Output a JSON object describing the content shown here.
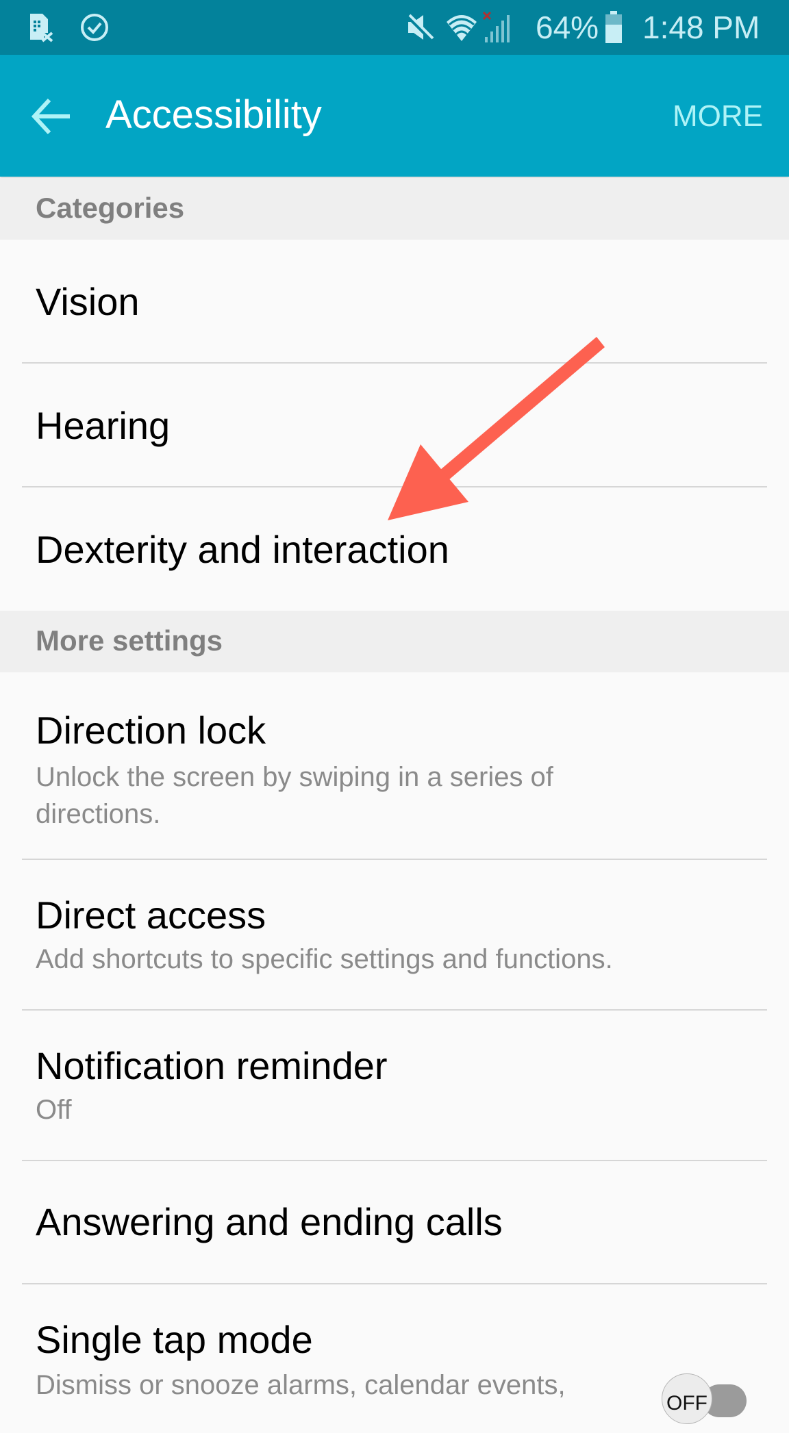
{
  "status_bar": {
    "left_icons": [
      "sim-card-error-icon",
      "check-circle-icon"
    ],
    "right_icons": [
      "mute-icon",
      "wifi-icon",
      "signal-no-service-icon",
      "battery-icon"
    ],
    "battery_percent": "64%",
    "time": "1:48 PM",
    "background_color": "#03829b"
  },
  "app_bar": {
    "title": "Accessibility",
    "back_icon": "arrow-left-icon",
    "more_label": "MORE",
    "background_color": "#02a5c4"
  },
  "sections": [
    {
      "header": "Categories",
      "items": [
        {
          "title": "Vision"
        },
        {
          "title": "Hearing"
        },
        {
          "title": "Dexterity and interaction"
        }
      ]
    },
    {
      "header": "More settings",
      "items": [
        {
          "title": "Direction lock",
          "subtitle": "Unlock the screen by swiping in a series of directions."
        },
        {
          "title": "Direct access",
          "subtitle": "Add shortcuts to specific settings and functions."
        },
        {
          "title": "Notification reminder",
          "subtitle": "Off"
        },
        {
          "title": "Answering and ending calls"
        },
        {
          "title": "Single tap mode",
          "subtitle": "Dismiss or snooze alarms, calendar events,",
          "toggle": {
            "state": "OFF"
          }
        }
      ]
    }
  ],
  "annotation": {
    "type": "arrow",
    "points_to": "Dexterity and interaction",
    "color": "#fd6150"
  }
}
